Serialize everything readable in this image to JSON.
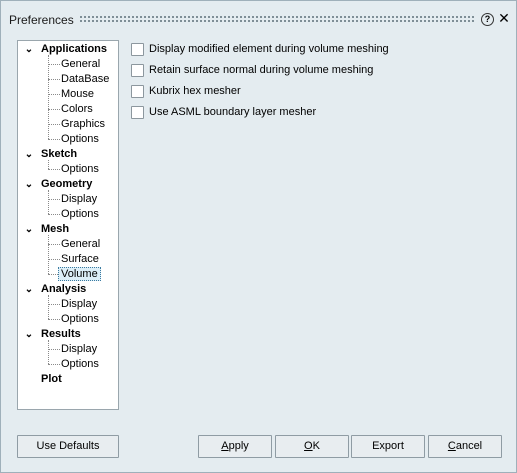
{
  "window": {
    "title": "Preferences",
    "help_icon": "question-circle-icon",
    "close_icon": "close-icon",
    "close_glyph": "✕",
    "help_glyph": "?"
  },
  "tree": {
    "categories": [
      {
        "label": "Applications",
        "children": [
          "General",
          "DataBase",
          "Mouse",
          "Colors",
          "Graphics",
          "Options"
        ]
      },
      {
        "label": "Sketch",
        "children": [
          "Options"
        ]
      },
      {
        "label": "Geometry",
        "children": [
          "Display",
          "Options"
        ]
      },
      {
        "label": "Mesh",
        "children": [
          "General",
          "Surface",
          "Volume"
        ]
      },
      {
        "label": "Analysis",
        "children": [
          "Display",
          "Options"
        ]
      },
      {
        "label": "Results",
        "children": [
          "Display",
          "Options"
        ]
      },
      {
        "label": "Plot",
        "children": []
      }
    ],
    "selected": "Mesh/Volume",
    "expand_glyph": "⌄"
  },
  "options": [
    {
      "label": "Display modified element during volume meshing",
      "checked": false
    },
    {
      "label": "Retain surface normal during volume meshing",
      "checked": false
    },
    {
      "label": "Kubrix hex mesher",
      "checked": false
    },
    {
      "label": "Use ASML boundary layer mesher",
      "checked": false
    }
  ],
  "buttons": {
    "use_defaults": "Use Defaults",
    "apply_first": "A",
    "apply_rest": "pply",
    "ok_first": "O",
    "ok_rest": "K",
    "export": "Export",
    "cancel_first": "C",
    "cancel_rest": "ancel"
  }
}
